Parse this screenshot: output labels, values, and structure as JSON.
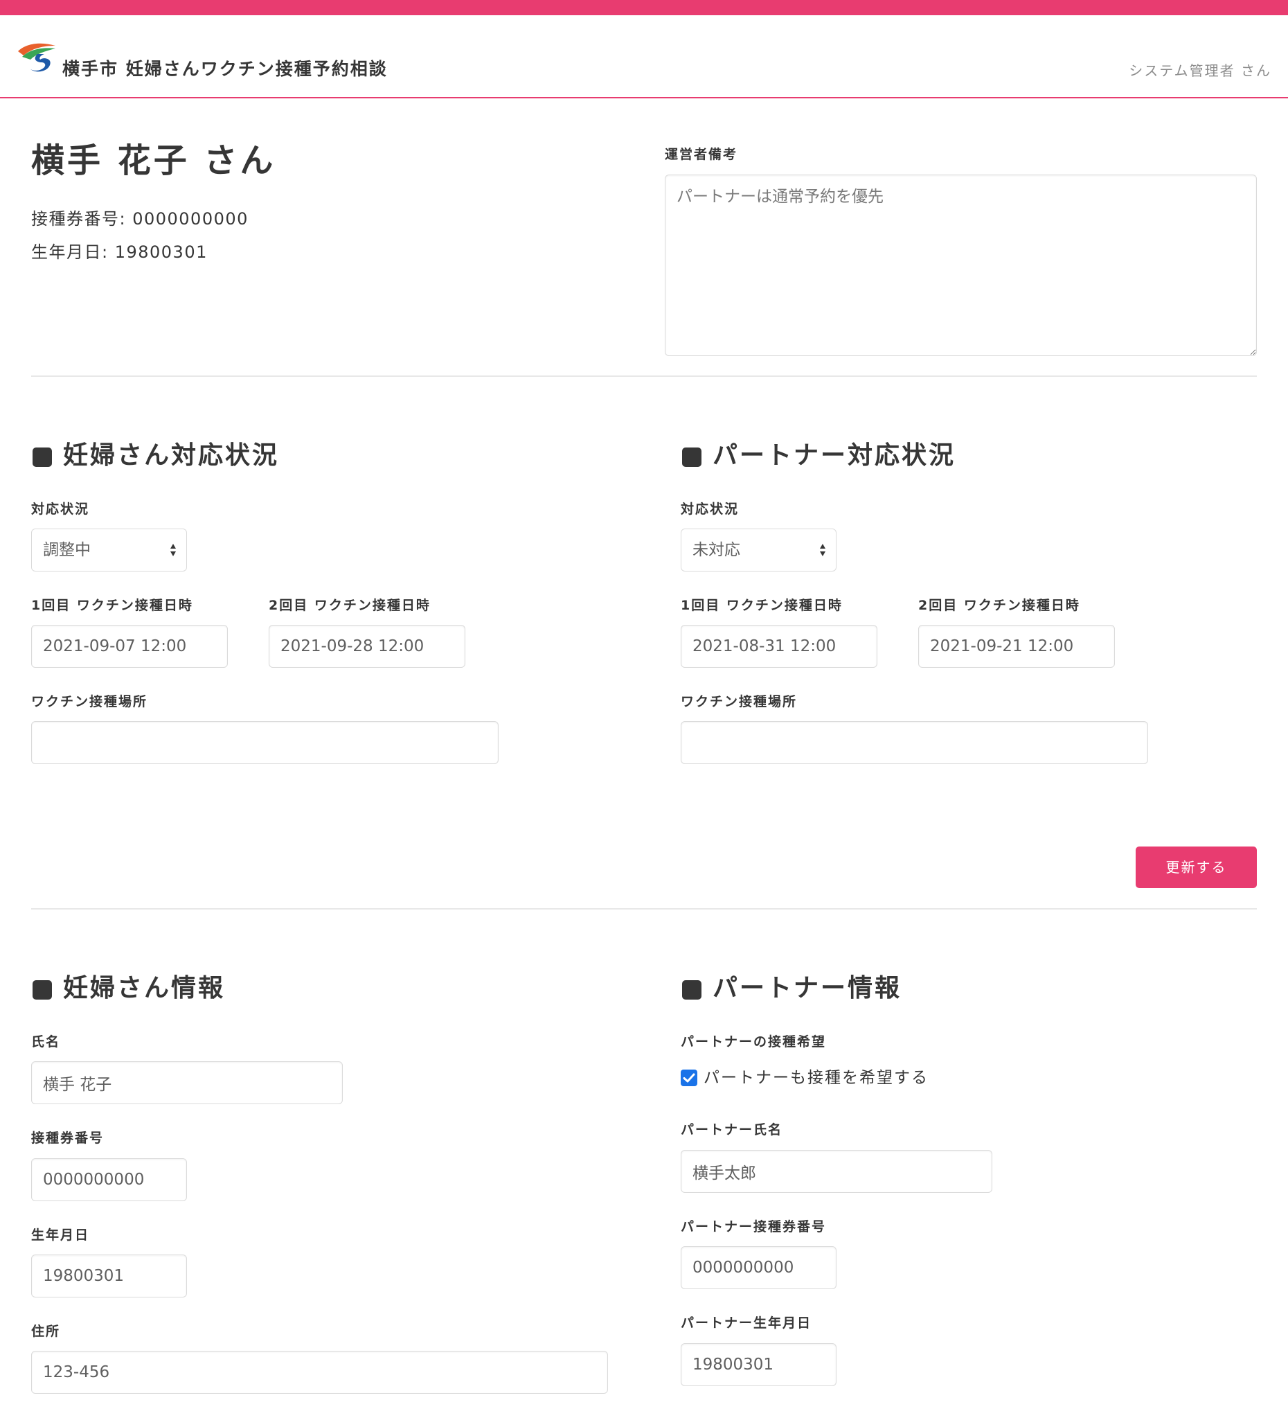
{
  "header": {
    "app_title": "横手市 妊婦さんワクチン接種予約相談",
    "user_name": "システム管理者 さん"
  },
  "profile": {
    "name": "横手 花子 さん",
    "ticket_line": "接種券番号: 0000000000",
    "birth_line": "生年月日: 19800301"
  },
  "notes": {
    "label": "運営者備考",
    "value": "パートナーは通常予約を優先"
  },
  "pregnant_status": {
    "title": "妊婦さん対応状況",
    "status_label": "対応状況",
    "status_value": "調整中",
    "dose1_label": "1回目 ワクチン接種日時",
    "dose1_value": "2021-09-07 12:00",
    "dose2_label": "2回目 ワクチン接種日時",
    "dose2_value": "2021-09-28 12:00",
    "place_label": "ワクチン接種場所",
    "place_value": ""
  },
  "partner_status": {
    "title": "パートナー対応状況",
    "status_label": "対応状況",
    "status_value": "未対応",
    "dose1_label": "1回目 ワクチン接種日時",
    "dose1_value": "2021-08-31 12:00",
    "dose2_label": "2回目 ワクチン接種日時",
    "dose2_value": "2021-09-21 12:00",
    "place_label": "ワクチン接種場所",
    "place_value": ""
  },
  "update_button": "更新する",
  "pregnant_info": {
    "title": "妊婦さん情報",
    "name_label": "氏名",
    "name_value": "横手 花子",
    "ticket_label": "接種券番号",
    "ticket_value": "0000000000",
    "birth_label": "生年月日",
    "birth_value": "19800301",
    "address_label": "住所",
    "address_value": "123-456"
  },
  "partner_info": {
    "title": "パートナー情報",
    "wish_label": "パートナーの接種希望",
    "wish_checkbox_label": "パートナーも接種を希望する",
    "wish_checked": true,
    "name_label": "パートナー氏名",
    "name_value": "横手太郎",
    "ticket_label": "パートナー接種券番号",
    "ticket_value": "0000000000",
    "birth_label": "パートナー生年月日",
    "birth_value": "19800301"
  },
  "colors": {
    "accent": "#e83c70",
    "checkbox": "#1a73e8",
    "text": "#363636"
  }
}
